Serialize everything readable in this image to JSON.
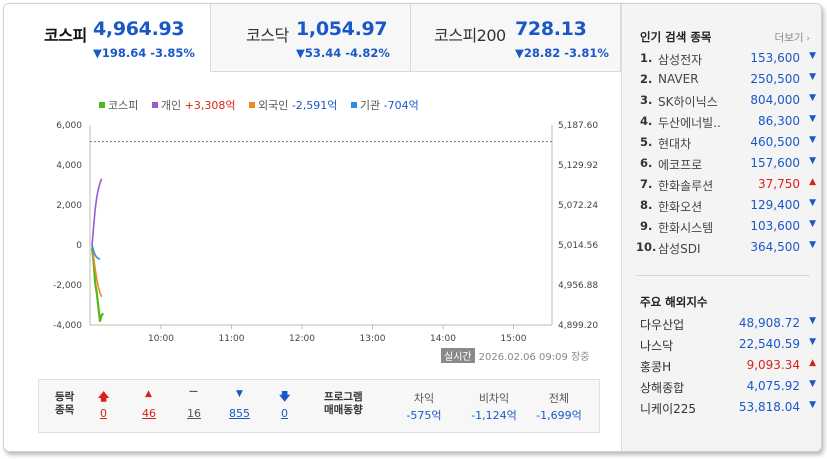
{
  "tabs": [
    {
      "name": "코스피",
      "value": "4,964.93",
      "change": "▼198.64 -3.85%",
      "active": true
    },
    {
      "name": "코스닥",
      "value": "1,054.97",
      "change": "▼53.44 -4.82%",
      "active": false
    },
    {
      "name": "코스피200",
      "value": "728.13",
      "change": "▼28.82 -3.81%",
      "active": false
    }
  ],
  "legend": [
    {
      "label": "코스피",
      "value": "",
      "color": "#52b817"
    },
    {
      "label": "개인",
      "value": "+3,308억",
      "color": "#9b59d0",
      "valueColor": "#d9231a"
    },
    {
      "label": "외국인",
      "value": "-2,591억",
      "color": "#f08a24",
      "valueColor": "#1a58c7"
    },
    {
      "label": "기관",
      "value": "-704억",
      "color": "#2d8fe0",
      "valueColor": "#1a58c7"
    }
  ],
  "chart_data": {
    "type": "line",
    "x_labels": [
      "10:00",
      "11:00",
      "12:00",
      "13:00",
      "14:00",
      "15:00"
    ],
    "y_left_ticks": [
      "6,000",
      "4,000",
      "2,000",
      "0",
      "-2,000",
      "-4,000"
    ],
    "y_left_range": [
      -4000,
      6000
    ],
    "y_right_ticks": [
      "5,187.60",
      "5,129.92",
      "5,072.24",
      "5,014.56",
      "4,956.88",
      "4,899.20"
    ],
    "y_right_range": [
      4899.2,
      5187.6
    ],
    "reference_line": 5163.57,
    "series": [
      {
        "name": "코스피",
        "axis": "right",
        "color": "#52b817",
        "values": [
          5010,
          4990,
          4960,
          4945,
          4925,
          4905,
          4913,
          4916
        ]
      },
      {
        "name": "개인",
        "axis": "left",
        "color": "#9b59d0",
        "values": [
          0,
          900,
          1800,
          2400,
          2800,
          3100,
          3308
        ]
      },
      {
        "name": "외국인",
        "axis": "left",
        "color": "#f08a24",
        "values": [
          0,
          -600,
          -1200,
          -1700,
          -2100,
          -2400,
          -2591
        ]
      },
      {
        "name": "기관",
        "axis": "left",
        "color": "#2d8fe0",
        "values": [
          0,
          -300,
          -500,
          -620,
          -680,
          -704
        ]
      }
    ]
  },
  "timestamp": {
    "badge": "실시간",
    "time": "2026.02.06 09:09",
    "status": "장중"
  },
  "breadth": {
    "label": [
      "등락",
      "종목"
    ],
    "items": [
      {
        "icon": "🡅",
        "value": "0",
        "color": "#d9231a"
      },
      {
        "icon": "▲",
        "value": "46",
        "color": "#d9231a"
      },
      {
        "icon": "—",
        "value": "16",
        "color": "#555555"
      },
      {
        "icon": "▼",
        "value": "855",
        "color": "#1a58c7"
      },
      {
        "icon": "🡇",
        "value": "0",
        "color": "#1a58c7"
      }
    ]
  },
  "program": {
    "label": [
      "프로그램",
      "매매동향"
    ],
    "columns": [
      {
        "header": "차익",
        "value": "-575억"
      },
      {
        "header": "비차익",
        "value": "-1,124억"
      },
      {
        "header": "전체",
        "value": "-1,699억"
      }
    ]
  },
  "popular": {
    "title": "인기 검색 종목",
    "more": "더보기",
    "items": [
      {
        "rank": "1.",
        "name": "삼성전자",
        "value": "153,600",
        "dir": "down"
      },
      {
        "rank": "2.",
        "name": "NAVER",
        "value": "250,500",
        "dir": "down"
      },
      {
        "rank": "3.",
        "name": "SK하이닉스",
        "value": "804,000",
        "dir": "down"
      },
      {
        "rank": "4.",
        "name": "두산에너빌..",
        "value": "86,300",
        "dir": "down"
      },
      {
        "rank": "5.",
        "name": "현대차",
        "value": "460,500",
        "dir": "down"
      },
      {
        "rank": "6.",
        "name": "에코프로",
        "value": "157,600",
        "dir": "down"
      },
      {
        "rank": "7.",
        "name": "한화솔루션",
        "value": "37,750",
        "dir": "up"
      },
      {
        "rank": "8.",
        "name": "한화오션",
        "value": "129,400",
        "dir": "down"
      },
      {
        "rank": "9.",
        "name": "한화시스템",
        "value": "103,600",
        "dir": "down"
      },
      {
        "rank": "10.",
        "name": "삼성SDI",
        "value": "364,500",
        "dir": "down"
      }
    ]
  },
  "world": {
    "title": "주요 해외지수",
    "items": [
      {
        "name": "다우산업",
        "value": "48,908.72",
        "dir": "down"
      },
      {
        "name": "나스닥",
        "value": "22,540.59",
        "dir": "down"
      },
      {
        "name": "홍콩H",
        "value": "9,093.34",
        "dir": "up"
      },
      {
        "name": "상해종합",
        "value": "4,075.92",
        "dir": "down"
      },
      {
        "name": "니케이225",
        "value": "53,818.04",
        "dir": "down"
      }
    ]
  },
  "colors": {
    "up": "#d9231a",
    "down": "#1a58c7",
    "accent": "#1a58c7"
  }
}
